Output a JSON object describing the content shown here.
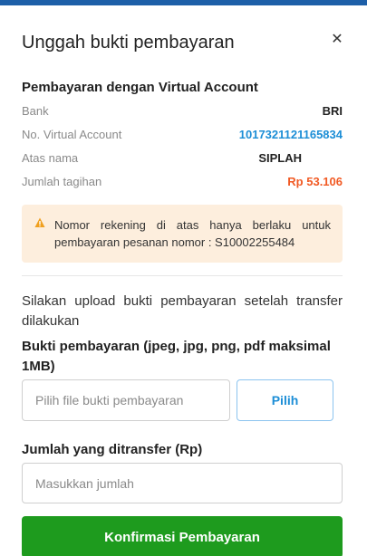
{
  "modal": {
    "title": "Unggah bukti pembayaran",
    "close_glyph": "✕"
  },
  "virtual_account": {
    "heading": "Pembayaran dengan Virtual Account",
    "rows": [
      {
        "label": "Bank",
        "value": "BRI"
      },
      {
        "label": "No. Virtual Account",
        "value": "1017321121165834"
      },
      {
        "label": "Atas nama",
        "value": "SIPLAH"
      },
      {
        "label": "Jumlah tagihan",
        "value": "Rp 53.106"
      }
    ]
  },
  "alert": {
    "icon": "warning-icon",
    "text": "Nomor rekening di atas hanya berlaku untuk pembayaran pesanan nomor : S10002255484"
  },
  "upload": {
    "instruction": "Silakan upload bukti pembayaran setelah transfer dilakukan",
    "label": "Bukti pembayaran (jpeg, jpg, png, pdf maksimal 1MB)",
    "placeholder": "Pilih file bukti pembayaran",
    "pick_label": "Pilih"
  },
  "transfer": {
    "label": "Jumlah yang ditransfer (Rp)",
    "placeholder": "Masukkan jumlah"
  },
  "confirm_label": "Konfirmasi Pembayaran",
  "colors": {
    "brand_blue": "#1d5fa8",
    "link_blue": "#1c8ed6",
    "amount_orange": "#f15a24",
    "alert_bg": "#fdeedd",
    "confirm_green": "#1e9b1e"
  }
}
